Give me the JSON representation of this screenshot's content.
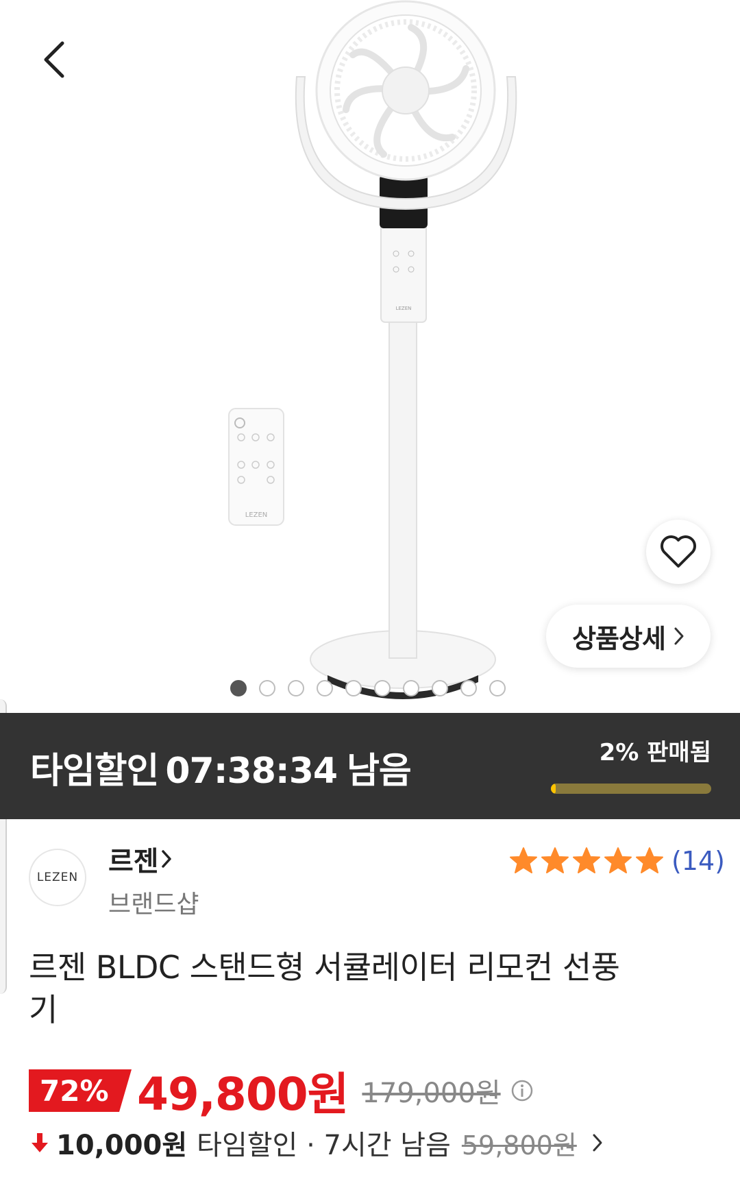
{
  "nav": {
    "back_icon": "chevron-left-icon"
  },
  "gallery": {
    "remote_logo": "LEZEN",
    "fan_logo": "LEZEN",
    "wish_icon": "heart-outline-icon",
    "detail_label": "상품상세",
    "dots": [
      true,
      false,
      false,
      false,
      false,
      false,
      false,
      false,
      false,
      false
    ]
  },
  "deal": {
    "prefix": "타임할인",
    "timer": "07:38:34",
    "suffix": "남음",
    "sold_label": "2% 판매됨",
    "sold_fraction": 0.02,
    "colors": {
      "bar_bg": "#333333",
      "progress": "#ffc400"
    }
  },
  "brand": {
    "logo_text": "LEZEN",
    "name": "르젠",
    "sub": "브랜드샵",
    "rating_stars": 5,
    "review_count": "(14)"
  },
  "product": {
    "title": "르젠 BLDC 스탠드형 서큘레이터 리모컨 선풍기"
  },
  "price": {
    "discount": "72%",
    "sale": "49,800원",
    "original": "179,000원",
    "info_icon": "info-circle-icon",
    "coupon_amount": "10,000원",
    "coupon_desc": "타임할인 · 7시간 남음",
    "coupon_original": "59,800원",
    "accent": "#e3191f"
  }
}
